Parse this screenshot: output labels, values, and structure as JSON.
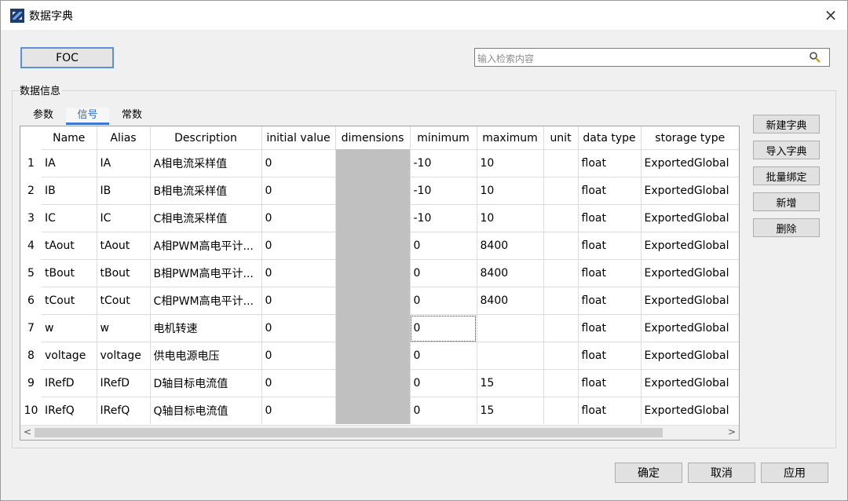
{
  "window": {
    "title": "数据字典",
    "close_glyph": "×"
  },
  "toolbar": {
    "module_button": "FOC"
  },
  "search": {
    "placeholder": "输入检索内容",
    "icon": "magnifier-icon"
  },
  "group": {
    "label": "数据信息"
  },
  "tabs": [
    {
      "label": "参数",
      "active": false
    },
    {
      "label": "信号",
      "active": true
    },
    {
      "label": "常数",
      "active": false
    }
  ],
  "table": {
    "headers": [
      "Name",
      "Alias",
      "Description",
      "initial value",
      "dimensions",
      "minimum",
      "maximum",
      "unit",
      "data  type",
      "storage type"
    ],
    "rows": [
      {
        "n": "1",
        "name": "IA",
        "alias": "IA",
        "desc": "A相电流采样值",
        "init": "0",
        "dim": "",
        "min": "-10",
        "max": "10",
        "unit": "",
        "dtype": "float",
        "stype": "ExportedGlobal"
      },
      {
        "n": "2",
        "name": "IB",
        "alias": "IB",
        "desc": "B相电流采样值",
        "init": "0",
        "dim": "",
        "min": "-10",
        "max": "10",
        "unit": "",
        "dtype": "float",
        "stype": "ExportedGlobal"
      },
      {
        "n": "3",
        "name": "IC",
        "alias": "IC",
        "desc": "C相电流采样值",
        "init": "0",
        "dim": "",
        "min": "-10",
        "max": "10",
        "unit": "",
        "dtype": "float",
        "stype": "ExportedGlobal"
      },
      {
        "n": "4",
        "name": "tAout",
        "alias": "tAout",
        "desc": "A相PWM高电平计...",
        "init": "0",
        "dim": "",
        "min": "0",
        "max": "8400",
        "unit": "",
        "dtype": "float",
        "stype": "ExportedGlobal"
      },
      {
        "n": "5",
        "name": "tBout",
        "alias": "tBout",
        "desc": "B相PWM高电平计...",
        "init": "0",
        "dim": "",
        "min": "0",
        "max": "8400",
        "unit": "",
        "dtype": "float",
        "stype": "ExportedGlobal"
      },
      {
        "n": "6",
        "name": "tCout",
        "alias": "tCout",
        "desc": "C相PWM高电平计...",
        "init": "0",
        "dim": "",
        "min": "0",
        "max": "8400",
        "unit": "",
        "dtype": "float",
        "stype": "ExportedGlobal"
      },
      {
        "n": "7",
        "name": "w",
        "alias": "w",
        "desc": "电机转速",
        "init": "0",
        "dim": "",
        "min": "0",
        "max": "",
        "unit": "",
        "dtype": "float",
        "stype": "ExportedGlobal"
      },
      {
        "n": "8",
        "name": "voltage",
        "alias": "voltage",
        "desc": "供电电源电压",
        "init": "0",
        "dim": "",
        "min": "0",
        "max": "",
        "unit": "",
        "dtype": "float",
        "stype": "ExportedGlobal"
      },
      {
        "n": "9",
        "name": "IRefD",
        "alias": "IRefD",
        "desc": "D轴目标电流值",
        "init": "0",
        "dim": "",
        "min": "0",
        "max": "15",
        "unit": "",
        "dtype": "float",
        "stype": "ExportedGlobal"
      },
      {
        "n": "10",
        "name": "IRefQ",
        "alias": "IRefQ",
        "desc": "Q轴目标电流值",
        "init": "0",
        "dim": "",
        "min": "0",
        "max": "15",
        "unit": "",
        "dtype": "float",
        "stype": "ExportedGlobal"
      }
    ],
    "scroll": {
      "left": "<",
      "right": ">"
    }
  },
  "side_buttons": [
    "新建字典",
    "导入字典",
    "批量绑定",
    "新增",
    "删除"
  ],
  "footer_buttons": {
    "ok": "确定",
    "cancel": "取消",
    "apply": "应用"
  },
  "colors": {
    "accent": "#3c78d8",
    "dimension_cell": "#c0c0c0"
  }
}
